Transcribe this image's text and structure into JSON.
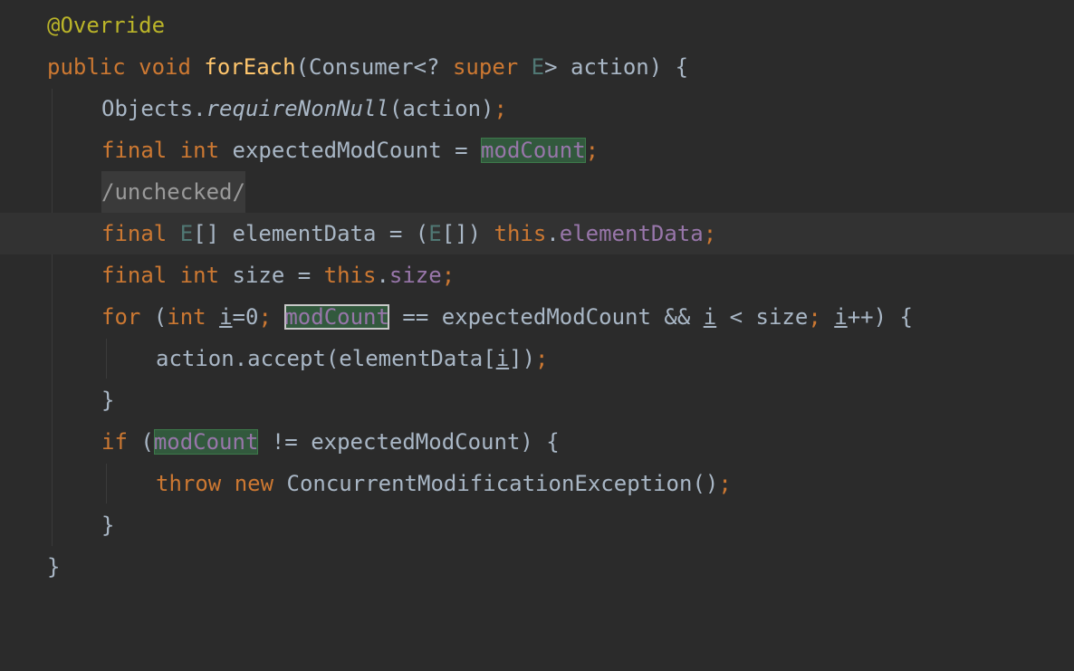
{
  "editor": {
    "lines": {
      "l1": {
        "annotation": "@Override"
      },
      "l2": {
        "kw_public": "public",
        "kw_void": "void",
        "method": "forEach",
        "open": "(",
        "type_consumer": "Consumer<? ",
        "kw_super": "super",
        "type_e": " E",
        "close": "> action) {"
      },
      "l3": {
        "obj": "Objects.",
        "call": "requireNonNull",
        "args": "(action)",
        "semi": ";"
      },
      "l4": {
        "kw_final": "final",
        "kw_int": "int",
        "decl": " expectedModCount = ",
        "field": "modCount",
        "semi": ";"
      },
      "l5": {
        "comment": "/unchecked/"
      },
      "l6": {
        "kw_final": "final",
        "type_e": "E",
        "rest1": "[] elementData = (",
        "type_e2": "E",
        "rest2": "[]) ",
        "kw_this": "this",
        "dot": ".",
        "field": "elementData",
        "semi": ";"
      },
      "l7": {
        "kw_final": "final",
        "kw_int": "int",
        "decl": " size = ",
        "kw_this": "this",
        "dot": ".",
        "field": "size",
        "semi": ";"
      },
      "l8": {
        "kw_for": "for",
        "p1": " (",
        "kw_int": "int",
        "sp": " ",
        "var_i": "i",
        "init": "=0",
        "semi1": ";",
        "sp2": " ",
        "field": "modCount",
        "cond": " == expectedModCount && ",
        "var_i2": "i",
        "cond2": " < size",
        "semi2": ";",
        "sp3": " ",
        "var_i3": "i",
        "end": "++) {"
      },
      "l9": {
        "call": "action.accept(elementData[",
        "var_i": "i",
        "close": "])",
        "semi": ";"
      },
      "l10": {
        "brace": "}"
      },
      "l11": {
        "kw_if": "if",
        "p1": " (",
        "field": "modCount",
        "rest": " != expectedModCount) {"
      },
      "l12": {
        "kw_throw": "throw",
        "kw_new": "new",
        "ctor": " ConcurrentModificationException()",
        "semi": ";"
      },
      "l13": {
        "brace": "}"
      },
      "l14": {
        "brace": "}"
      }
    }
  },
  "colors": {
    "background": "#2b2b2b",
    "keyword": "#cc7832",
    "annotation": "#bbb529",
    "method_decl": "#ffc66d",
    "field": "#9876aa",
    "text": "#a9b7c6",
    "highlight": "#32593d"
  }
}
